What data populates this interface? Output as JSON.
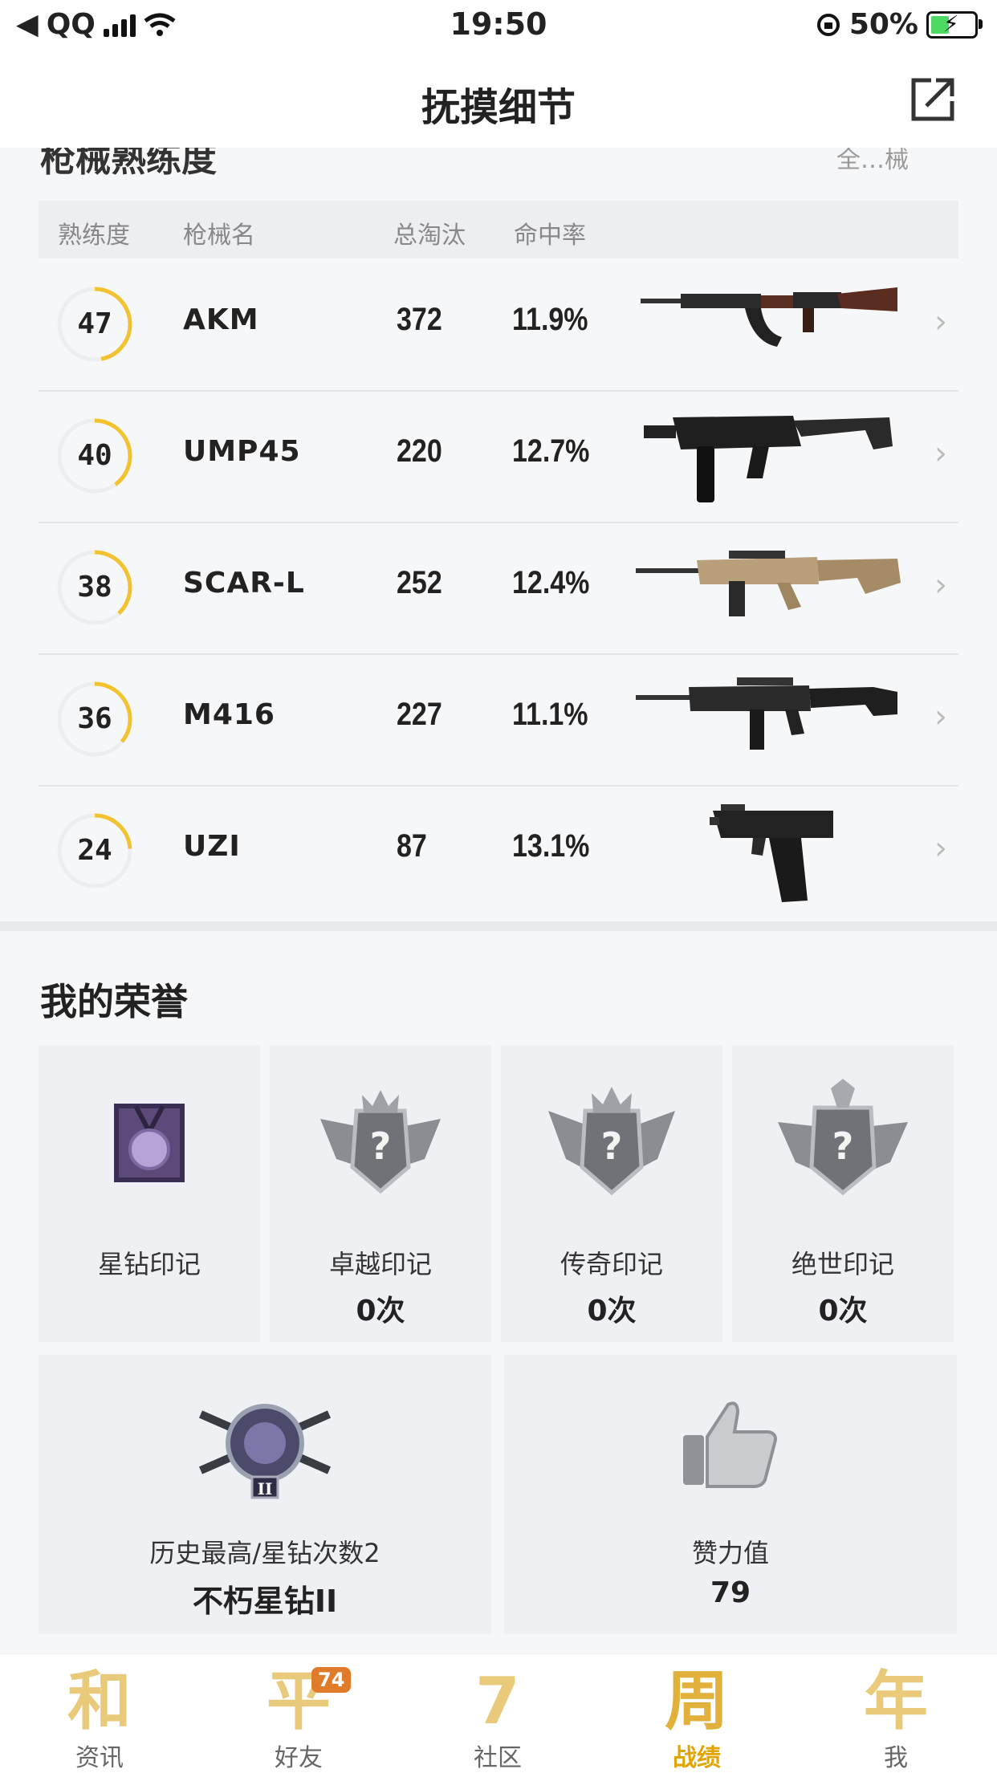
{
  "status": {
    "carrier": "QQ",
    "time": "19:50",
    "battery": "50%"
  },
  "nav": {
    "title": "抚摸细节"
  },
  "weapons": {
    "section_title": "枪械熟练度",
    "more": "全…械",
    "columns": [
      "熟练度",
      "枪械名",
      "总淘汰",
      "命中率"
    ],
    "rows": [
      {
        "level": "47",
        "level_fraction": 0.47,
        "name": "AKM",
        "kills": "372",
        "hit": "11.9%"
      },
      {
        "level": "40",
        "level_fraction": 0.4,
        "name": "UMP45",
        "kills": "220",
        "hit": "12.7%"
      },
      {
        "level": "38",
        "level_fraction": 0.38,
        "name": "SCAR-L",
        "kills": "252",
        "hit": "12.4%"
      },
      {
        "level": "36",
        "level_fraction": 0.36,
        "name": "M416",
        "kills": "227",
        "hit": "11.1%"
      },
      {
        "level": "24",
        "level_fraction": 0.24,
        "name": "UZI",
        "kills": "87",
        "hit": "13.1%"
      }
    ]
  },
  "honors": {
    "title": "我的荣誉",
    "marks": [
      {
        "label": "星钻印记",
        "count": ""
      },
      {
        "label": "卓越印记",
        "count": "0次"
      },
      {
        "label": "传奇印记",
        "count": "0次"
      },
      {
        "label": "绝世印记",
        "count": "0次"
      }
    ],
    "rank": {
      "label": "历史最高/星钻次数2",
      "value": "不朽星钻II"
    },
    "likes": {
      "label": "赞力值",
      "value": "79"
    }
  },
  "tabs": [
    {
      "glyph": "和",
      "label": "资讯"
    },
    {
      "glyph": "平",
      "label": "好友",
      "badge": "74"
    },
    {
      "glyph": "7",
      "label": "社区"
    },
    {
      "glyph": "周",
      "label": "战绩"
    },
    {
      "glyph": "年",
      "label": "我"
    }
  ],
  "colors": {
    "accent": "#f2c230",
    "ring_track": "#eceef0",
    "tab_active": "#e2a400"
  }
}
